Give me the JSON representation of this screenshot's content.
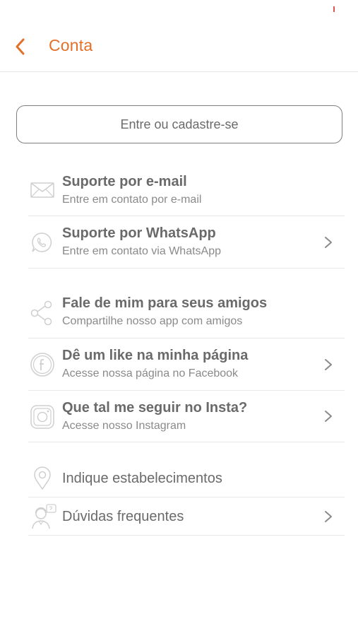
{
  "header": {
    "title": "Conta"
  },
  "login": {
    "label": "Entre ou cadastre-se"
  },
  "rows": [
    {
      "title": "Suporte por e-mail",
      "subtitle": "Entre em contato por e-mail",
      "icon": "mail-icon",
      "chevron": false
    },
    {
      "title": "Suporte por WhatsApp",
      "subtitle": "Entre em contato via WhatsApp",
      "icon": "whatsapp-icon",
      "chevron": true
    },
    {
      "title": "Fale de mim para seus amigos",
      "subtitle": "Compartilhe nosso app com amigos",
      "icon": "share-icon",
      "chevron": false
    },
    {
      "title": "Dê um like na minha página",
      "subtitle": "Acesse nossa página no Facebook",
      "icon": "facebook-icon",
      "chevron": true
    },
    {
      "title": "Que tal me seguir no Insta?",
      "subtitle": "Acesse nosso Instagram",
      "icon": "instagram-icon",
      "chevron": true
    },
    {
      "title": "Indique estabelecimentos",
      "icon": "location-pin-icon",
      "chevron": false
    },
    {
      "title": "Dúvidas frequentes",
      "icon": "faq-person-icon",
      "chevron": true
    }
  ],
  "colors": {
    "accent": "#e1702a",
    "text": "#6a6a6a",
    "subtext": "#8a8a8a",
    "divider": "#e8e8e8"
  }
}
